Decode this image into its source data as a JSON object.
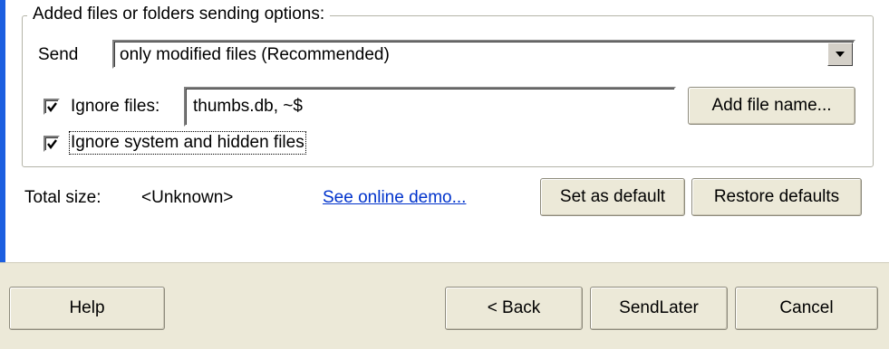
{
  "options_group": {
    "legend": "Added files or folders sending options:",
    "send_label": "Send",
    "send_selected": "only modified files (Recommended)",
    "ignore_files_label": "Ignore files:",
    "ignore_files_checked": true,
    "ignore_files_value": "thumbs.db, ~$",
    "add_file_name_label": "Add file name...",
    "ignore_system_label": "Ignore system and hidden files",
    "ignore_system_checked": true
  },
  "summary": {
    "total_size_label": "Total size:",
    "total_size_value": "<Unknown>",
    "demo_link": "See online demo...",
    "set_default_label": "Set as default",
    "restore_defaults_label": "Restore defaults"
  },
  "footer": {
    "help_label": "Help",
    "back_label": "< Back",
    "send_later_label": "SendLater",
    "cancel_label": "Cancel"
  },
  "colors": {
    "accent": "#1c5fe0",
    "link": "#0033cc",
    "panel": "#ffffff",
    "chrome": "#ece9d8"
  }
}
